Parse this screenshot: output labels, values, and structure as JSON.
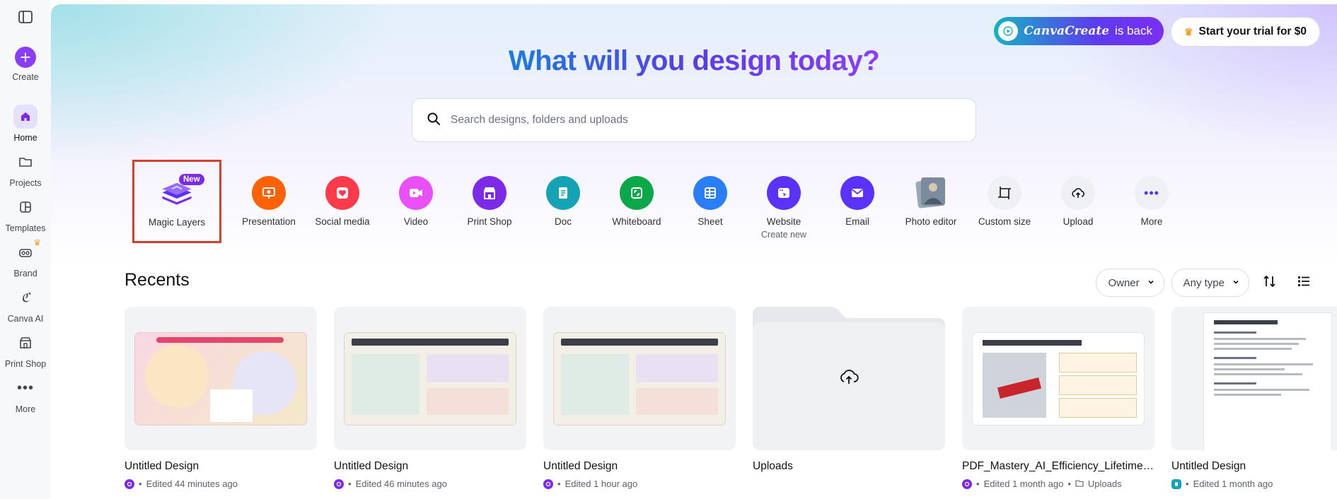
{
  "sidebar": {
    "items": [
      {
        "label": "Create"
      },
      {
        "label": "Home"
      },
      {
        "label": "Projects"
      },
      {
        "label": "Templates"
      },
      {
        "label": "Brand"
      },
      {
        "label": "Canva AI"
      },
      {
        "label": "Print Shop"
      },
      {
        "label": "More"
      }
    ]
  },
  "header": {
    "canva_create_brand": "CanvaCreate",
    "canva_create_suffix": "is back",
    "trial_label": "Start your trial for $0",
    "headline": "What will you design today?"
  },
  "search": {
    "placeholder": "Search designs, folders and uploads"
  },
  "shortcuts": [
    {
      "label": "Magic Layers",
      "badge": "New",
      "color": "#7d2ae8",
      "icon": "magic-layers-icon"
    },
    {
      "label": "Presentation",
      "color": "#ff6105",
      "icon": "presentation-icon"
    },
    {
      "label": "Social media",
      "color": "#ff3b4b",
      "icon": "heart-icon"
    },
    {
      "label": "Video",
      "color": "#e950f7",
      "icon": "video-icon"
    },
    {
      "label": "Print Shop",
      "color": "#7d2ae8",
      "icon": "shop-icon"
    },
    {
      "label": "Doc",
      "color": "#13a3b5",
      "icon": "doc-icon"
    },
    {
      "label": "Whiteboard",
      "color": "#0ba84a",
      "icon": "whiteboard-icon"
    },
    {
      "label": "Sheet",
      "color": "#2a7ef7",
      "icon": "sheet-icon"
    },
    {
      "label": "Website",
      "sub": "Create new",
      "color": "#5a32fa",
      "icon": "website-icon"
    },
    {
      "label": "Email",
      "color": "#5a32fa",
      "icon": "email-icon"
    },
    {
      "label": "Photo editor",
      "color": "#7a8c9e",
      "icon": "photo-editor-icon"
    },
    {
      "label": "Custom size",
      "color": "#eef0f3",
      "icon": "custom-size-icon"
    },
    {
      "label": "Upload",
      "color": "#eef0f3",
      "icon": "upload-cloud-icon"
    },
    {
      "label": "More",
      "color": "#eef0f3",
      "icon": "more-dots-icon"
    }
  ],
  "recents": {
    "title": "Recents",
    "owner_label": "Owner",
    "type_label": "Any type",
    "items": [
      {
        "title": "Untitled Design",
        "meta": "Edited 44 minutes ago",
        "kind": "design"
      },
      {
        "title": "Untitled Design",
        "meta": "Edited 46 minutes ago",
        "kind": "design"
      },
      {
        "title": "Untitled Design",
        "meta": "Edited 1 hour ago",
        "kind": "design"
      },
      {
        "title": "Uploads",
        "meta": "",
        "kind": "folder"
      },
      {
        "title": "PDF_Mastery_AI_Efficiency_Lifetime_...",
        "meta": "Edited 1 month ago",
        "folder": "Uploads",
        "kind": "design"
      },
      {
        "title": "Untitled Design",
        "meta": "Edited 1 month ago",
        "kind": "doc"
      }
    ]
  },
  "colors": {
    "brand_purple": "#8b3dff",
    "highlight_red": "#d4402b"
  }
}
